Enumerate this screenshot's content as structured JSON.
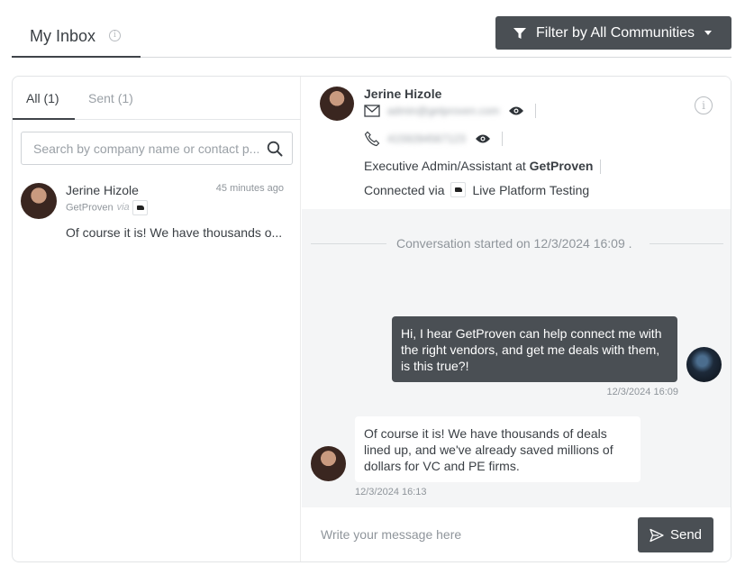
{
  "header": {
    "title": "My Inbox",
    "info_icon": "info-icon",
    "filter_label": "Filter by All Communities",
    "filter_icon": "funnel-icon",
    "caret_icon": "caret-down-icon"
  },
  "tabs": [
    {
      "label": "All (1)",
      "active": true
    },
    {
      "label": "Sent (1)",
      "active": false
    }
  ],
  "search": {
    "placeholder": "Search by company name or contact p...",
    "icon": "search-icon"
  },
  "conversations": [
    {
      "name": "Jerine Hizole",
      "time": "45 minutes ago",
      "company": "GetProven",
      "via": "via",
      "snippet": "Of course it is! We have thousands o..."
    }
  ],
  "contact": {
    "name": "Jerine Hizole",
    "email_hidden": "admin@getproven.com",
    "phone_hidden": "4159284567123",
    "title_prefix": "Executive Admin/Assistant at",
    "company": "GetProven",
    "connected_prefix": "Connected via",
    "connected_platform": "Live Platform Testing"
  },
  "thread": {
    "started_label": "Conversation started on 12/3/2024 16:09 .",
    "messages": [
      {
        "direction": "outgoing",
        "text": "Hi, I hear GetProven can help connect me with the right vendors, and get me deals with them, is this true?!",
        "time": "12/3/2024 16:09"
      },
      {
        "direction": "incoming",
        "text": "Of course it is! We have thousands of deals lined up, and we've already saved millions of dollars for VC and PE firms.",
        "time": "12/3/2024 16:13"
      }
    ]
  },
  "composer": {
    "placeholder": "Write your message here",
    "send_label": "Send"
  },
  "colors": {
    "dark_button": "#4a4f54",
    "thread_bg": "#f4f5f6",
    "muted_text": "#8f959b"
  }
}
